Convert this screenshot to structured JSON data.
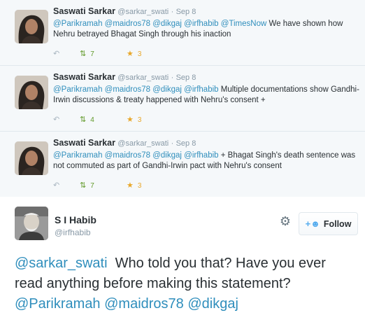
{
  "thread": [
    {
      "name": "Saswati Sarkar",
      "handle": "@sarkar_swati",
      "dot": "·",
      "time": "Sep 8",
      "mentions": "@Parikramah @maidros78 @dikgaj @irfhabib @TimesNow",
      "text": " We have shown how Nehru betrayed Bhagat Singh through his inaction",
      "retweets": "7",
      "favorites": "3"
    },
    {
      "name": "Saswati Sarkar",
      "handle": "@sarkar_swati",
      "dot": "·",
      "time": "Sep 8",
      "mentions": "@Parikramah @maidros78 @dikgaj @irfhabib",
      "text": " Multiple documentations show Gandhi-Irwin discussions & treaty happened with Nehru's consent +",
      "retweets": "4",
      "favorites": "3"
    },
    {
      "name": "Saswati Sarkar",
      "handle": "@sarkar_swati",
      "dot": "·",
      "time": "Sep 8",
      "mentions": "@Parikramah @maidros78 @dikgaj @irfhabib",
      "text": " + Bhagat Singh's death sentence was not commuted as part of Gandhi-Irwin pact with Nehru's consent",
      "retweets": "7",
      "favorites": "3"
    }
  ],
  "main_tweet": {
    "name": "S I Habib",
    "handle": "@irfhabib",
    "follow_label": "Follow",
    "lead_mention": "@sarkar_swati",
    "text": "  Who told you that? Have you ever read anything before making this statement? ",
    "trailing_mentions": "@Parikramah @maidros78 @dikgaj"
  },
  "icons": {
    "reply": "reply-icon",
    "retweet": "retweet-icon",
    "favorite": "star-icon",
    "settings": "gear-icon",
    "follow": "add-user-icon"
  },
  "colors": {
    "mention": "#2f8ebc",
    "retweet": "#609928",
    "favorite": "#e8a72a",
    "thread_bg": "#f5f8fa"
  }
}
